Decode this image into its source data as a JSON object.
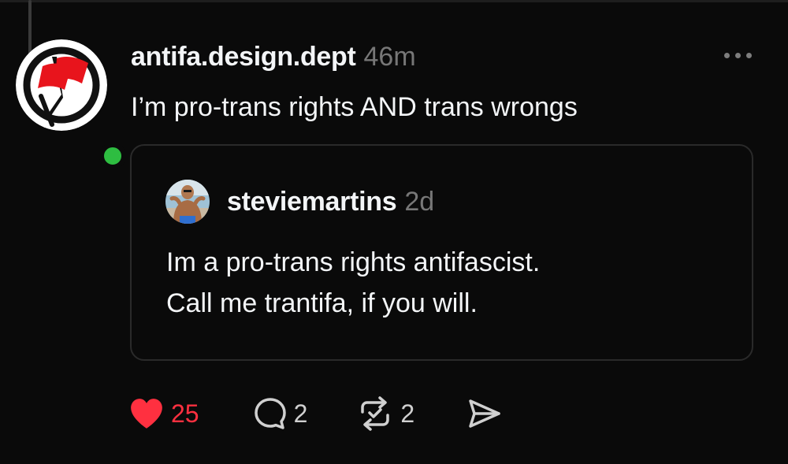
{
  "post": {
    "username": "antifa.design.dept",
    "time": "46m",
    "text": "I’m pro-trans rights AND trans wrongs",
    "avatar_icon": "antifa-flag-logo-icon",
    "online_color": "#2ebd41"
  },
  "quote": {
    "username": "steviemartins",
    "time": "2d",
    "lines": [
      "Im a pro-trans rights antifascist.",
      "Call me trantifa, if you will."
    ]
  },
  "actions": {
    "likes": "25",
    "replies": "2",
    "reposts": "2",
    "like_color": "#ff3040",
    "like_icon": "heart-icon",
    "reply_icon": "comment-bubble-icon",
    "repost_icon": "repost-icon",
    "share_icon": "send-icon"
  },
  "more_icon": "more-options-icon"
}
